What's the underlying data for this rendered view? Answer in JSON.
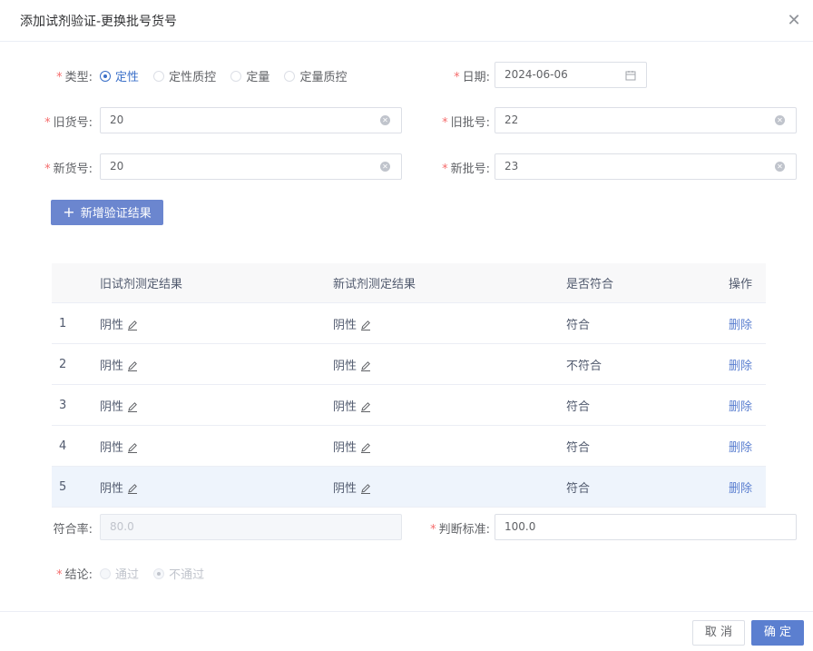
{
  "dialog": {
    "title": "添加试剂验证-更换批号货号",
    "close_icon": "close-icon"
  },
  "form": {
    "type": {
      "label": "类型:",
      "options": [
        {
          "label": "定性",
          "selected": true
        },
        {
          "label": "定性质控",
          "selected": false
        },
        {
          "label": "定量",
          "selected": false
        },
        {
          "label": "定量质控",
          "selected": false
        }
      ]
    },
    "date": {
      "label": "日期:",
      "value": "2024-06-06",
      "icon": "calendar-icon"
    },
    "old_item_no": {
      "label": "旧货号:",
      "value": "20"
    },
    "old_batch_no": {
      "label": "旧批号:",
      "value": "22"
    },
    "new_item_no": {
      "label": "新货号:",
      "value": "20"
    },
    "new_batch_no": {
      "label": "新批号:",
      "value": "23"
    },
    "add_button": "新增验证结果"
  },
  "table": {
    "headers": [
      "",
      "旧试剂测定结果",
      "新试剂测定结果",
      "是否符合",
      "操作"
    ],
    "rows": [
      {
        "index": "1",
        "old": "阴性",
        "new": "阴性",
        "match": "符合",
        "action": "删除"
      },
      {
        "index": "2",
        "old": "阴性",
        "new": "阴性",
        "match": "不符合",
        "action": "删除"
      },
      {
        "index": "3",
        "old": "阴性",
        "new": "阴性",
        "match": "符合",
        "action": "删除"
      },
      {
        "index": "4",
        "old": "阴性",
        "new": "阴性",
        "match": "符合",
        "action": "删除"
      },
      {
        "index": "5",
        "old": "阴性",
        "new": "阴性",
        "match": "符合",
        "action": "删除"
      }
    ]
  },
  "summary": {
    "rate": {
      "label": "符合率:",
      "value": "80.0"
    },
    "standard": {
      "label": "判断标准:",
      "value": "100.0"
    },
    "conclusion": {
      "label": "结论:",
      "options": [
        {
          "label": "通过",
          "selected": false
        },
        {
          "label": "不通过",
          "selected": true
        }
      ]
    }
  },
  "footer": {
    "cancel": "取 消",
    "confirm": "确 定"
  },
  "colors": {
    "primary": "#5b7fd0",
    "required": "#f56c6c",
    "highlight_row": "#eef4fc"
  }
}
